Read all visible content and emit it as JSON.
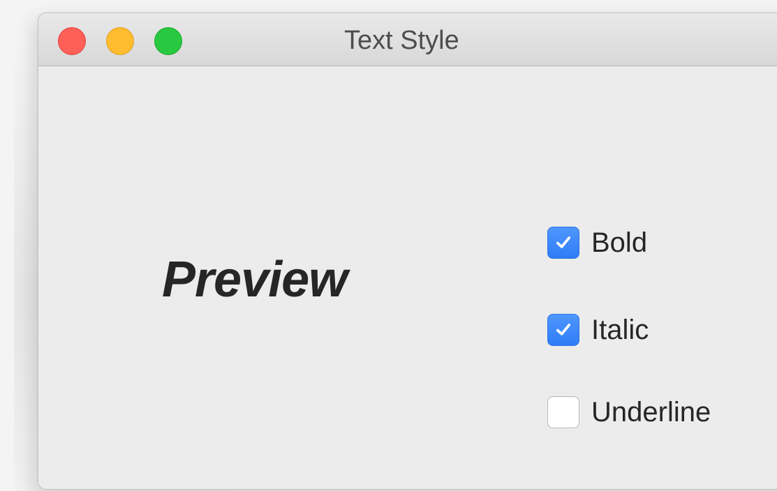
{
  "window": {
    "title": "Text Style"
  },
  "preview": {
    "text": "Preview"
  },
  "options": [
    {
      "label": "Bold",
      "checked": true
    },
    {
      "label": "Italic",
      "checked": true
    },
    {
      "label": "Underline",
      "checked": false
    }
  ],
  "colors": {
    "accent": "#3b86fa",
    "window_background": "#ececec",
    "close_button": "#fe5f57",
    "minimize_button": "#febc2e",
    "zoom_button": "#28c840"
  }
}
